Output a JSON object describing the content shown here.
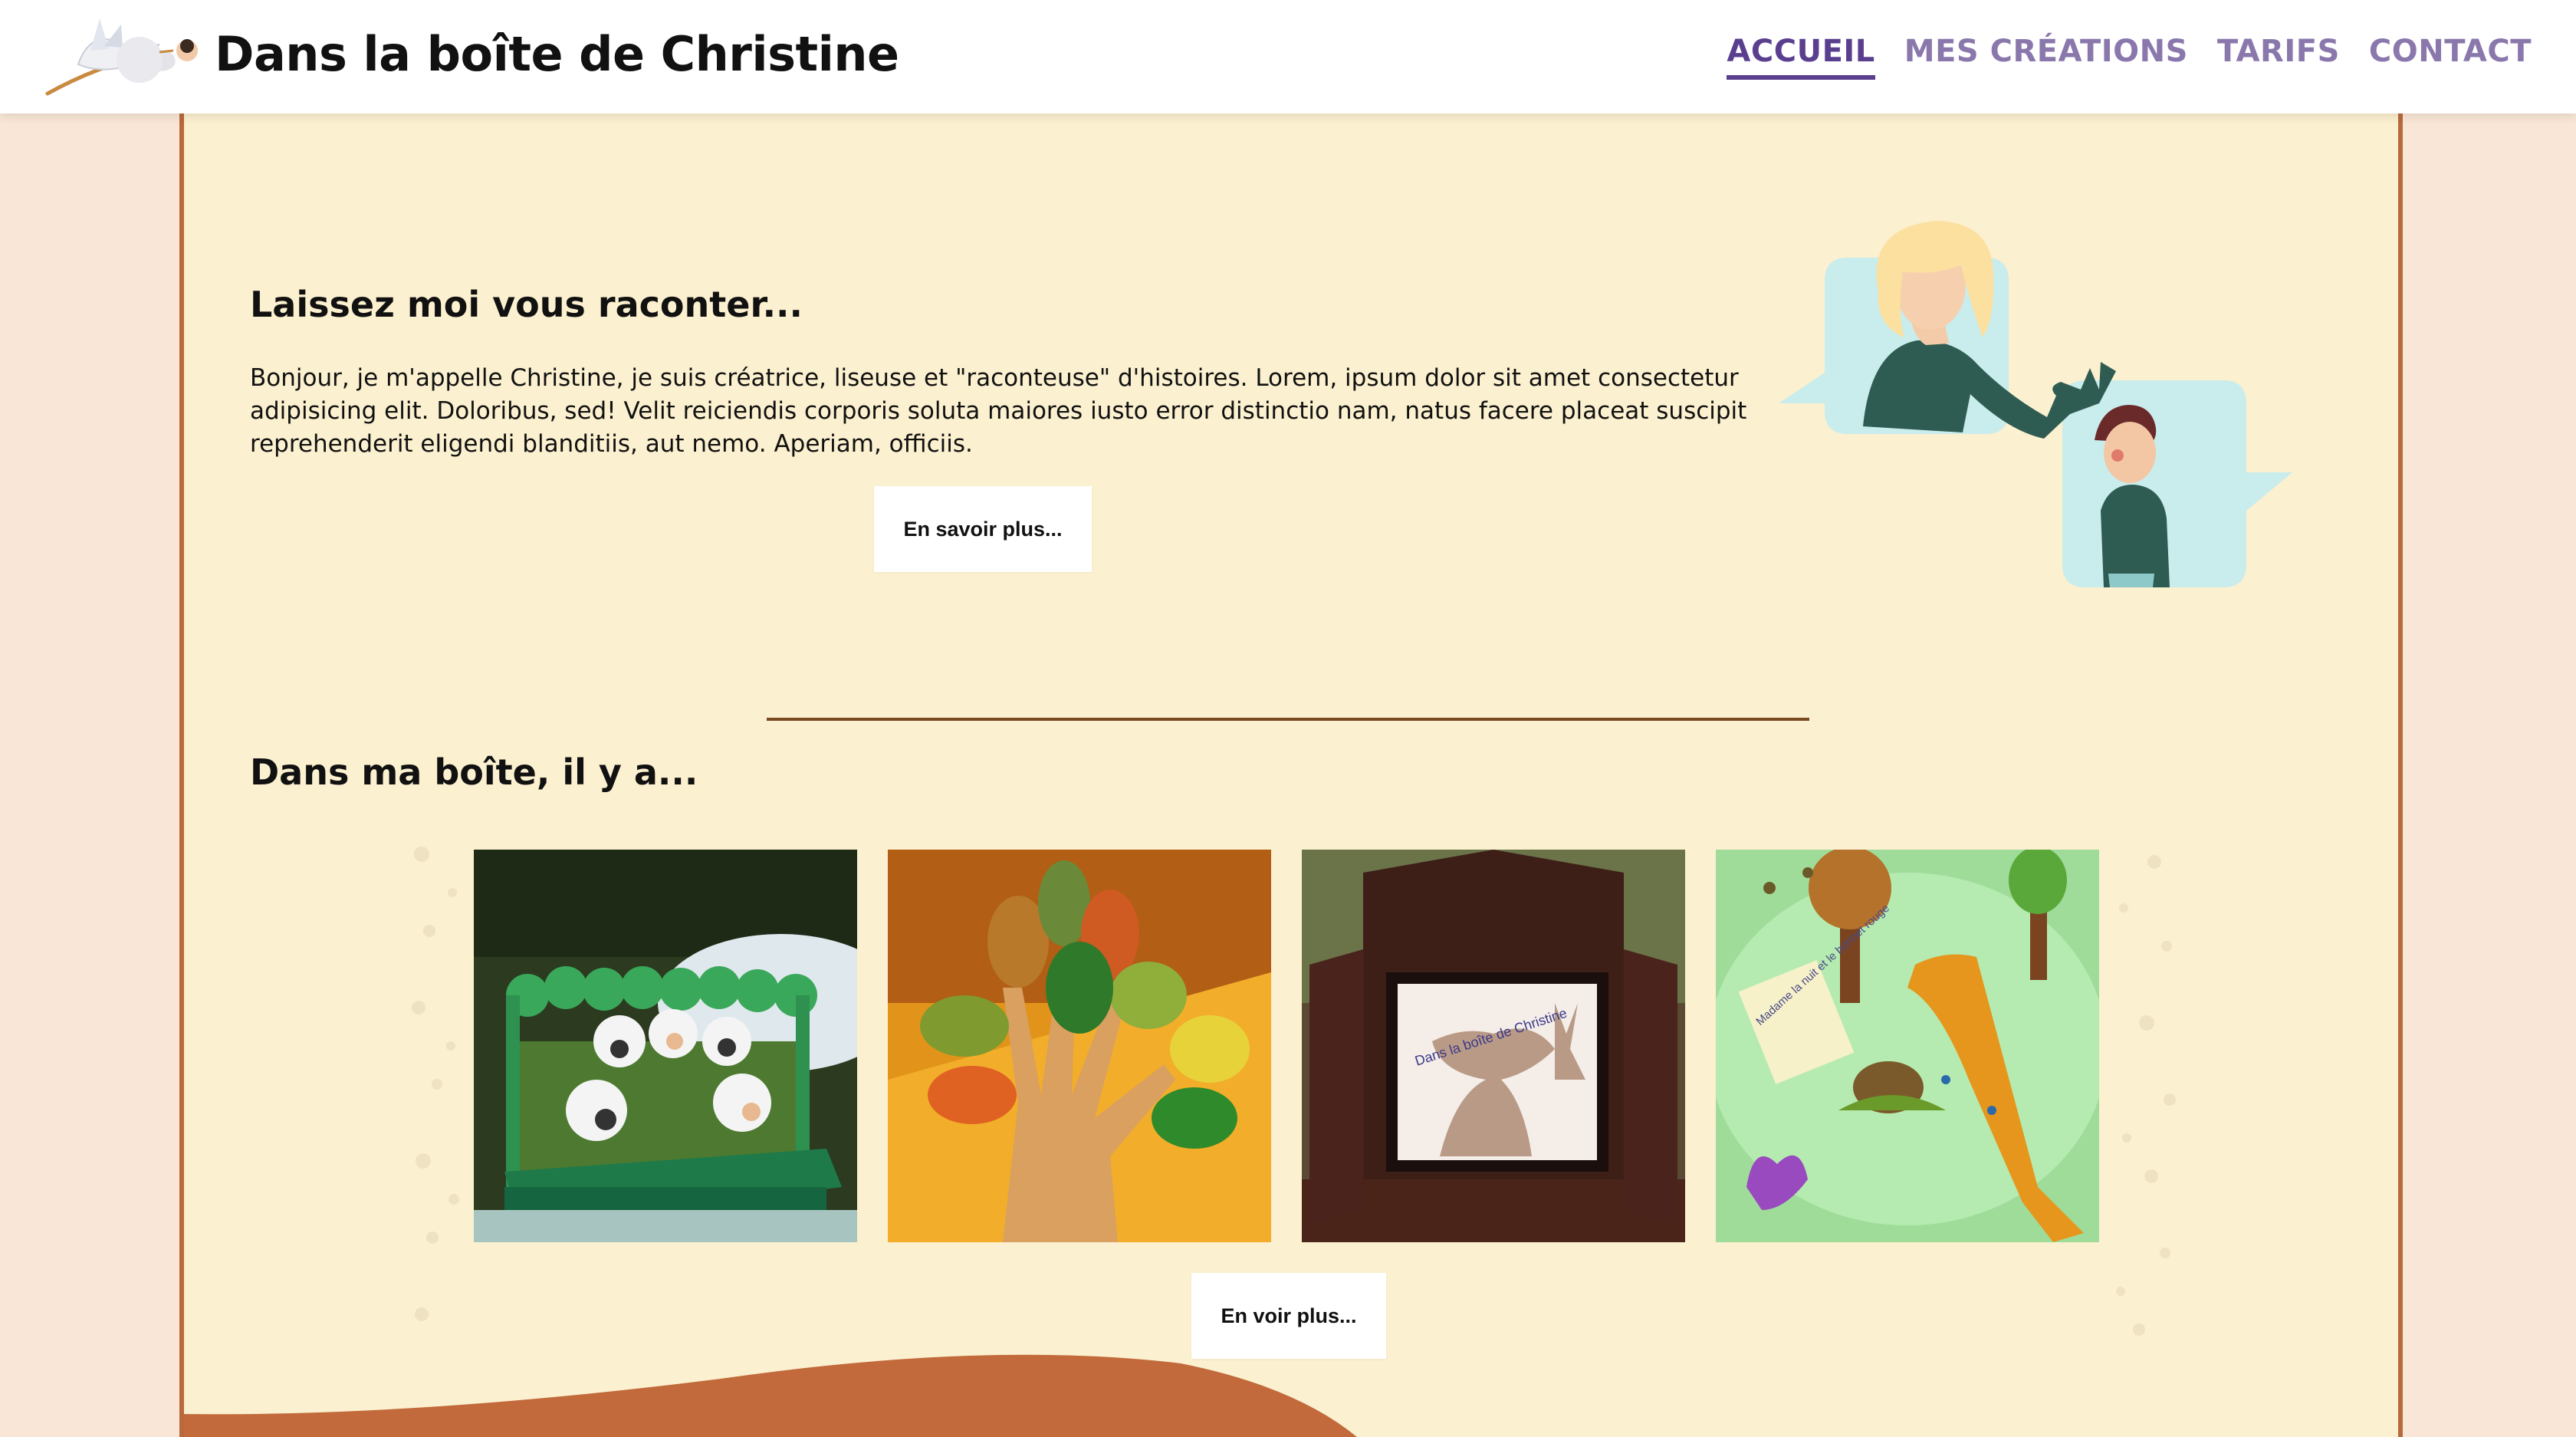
{
  "header": {
    "logo_icon": "stork-with-baby-icon",
    "brand": "Dans la boîte de Christine",
    "nav": [
      {
        "label": "ACCUEIL",
        "active": true
      },
      {
        "label": "MES CRÉATIONS",
        "active": false
      },
      {
        "label": "TARIFS",
        "active": false
      },
      {
        "label": "CONTACT",
        "active": false
      }
    ]
  },
  "intro": {
    "title": "Laissez moi vous raconter...",
    "text": "Bonjour, je m'appelle Christine, je suis créatrice, liseuse et \"raconteuse\" d'histoires. Lorem, ipsum dolor sit amet consectetur adipisicing elit. Doloribus, sed! Velit reiciendis corporis soluta maiores iusto error distinctio nam, natus facere placeat suscipit reprehenderit eligendi blanditiis, aut nemo. Aperiam, officiis.",
    "button": "En savoir plus...",
    "illustration": "storyteller-and-child-illustration"
  },
  "gallery": {
    "title": "Dans ma boîte, il y a...",
    "items": [
      {
        "name": "felt-sheep-box-photo"
      },
      {
        "name": "felt-leaves-glove-photo"
      },
      {
        "name": "shadow-theater-photo",
        "caption": "Dans la boîte de Christine"
      },
      {
        "name": "felt-story-mat-photo",
        "caption": "Madame la nuit et le bonnet rouge"
      }
    ],
    "button": "En voir plus..."
  },
  "colors": {
    "page_bg": "#f9e6d6",
    "content_bg": "#fbf0cf",
    "border_brown": "#b86a3d",
    "nav_active": "#5a3f8f",
    "nav_inactive": "#8a78ad",
    "wave": "#c26a3c"
  }
}
